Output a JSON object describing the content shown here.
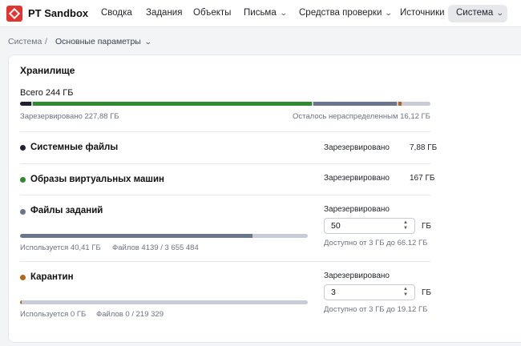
{
  "app": {
    "title": "PT Sandbox"
  },
  "nav": {
    "items": [
      {
        "label": "Сводка"
      },
      {
        "label": "Задания"
      },
      {
        "label": "Объекты"
      },
      {
        "label": "Письма"
      },
      {
        "label": "Средства проверки"
      },
      {
        "label": "Источники"
      },
      {
        "label": "Система"
      }
    ]
  },
  "breadcrumb": {
    "root": "Система",
    "separator": "/",
    "current": "Основные параметры"
  },
  "storage": {
    "title": "Хранилище",
    "total": "Всего 244 ГБ",
    "reserved": "Зарезервировано 227,88 ГБ",
    "remaining": "Осталось нераспределенным 16,12 ГБ",
    "segments": [
      {
        "name": "Системные файлы",
        "fraction": 0.032,
        "color": "#1f2329"
      },
      {
        "name": "Образы виртуальных машин",
        "fraction": 0.684,
        "color": "#2e8b2e"
      },
      {
        "name": "Файлы заданий",
        "fraction": 0.207,
        "color": "#6b7590"
      },
      {
        "name": "Карантин",
        "fraction": 0.012,
        "color": "#b5651d"
      }
    ]
  },
  "sections": {
    "system_files": {
      "title": "Системные файлы",
      "reserved_label": "Зарезервировано",
      "reserved_value": "7,88  ГБ",
      "color": "#1f2329"
    },
    "vm_images": {
      "title": "Образы виртуальных машин",
      "reserved_label": "Зарезервировано",
      "reserved_value": "167  ГБ",
      "color": "#2e8b2e"
    },
    "task_files": {
      "title": "Файлы заданий",
      "reserved_label": "Зарезервировано",
      "input_value": "50",
      "unit": "ГБ",
      "available": "Доступно от 3 ГБ до 66.12 ГБ",
      "used": "Используется 40,41 ГБ",
      "files": "Файлов 4139 / 3 655 484",
      "usage_fraction": 0.808,
      "color": "#6b7590"
    },
    "quarantine": {
      "title": "Карантин",
      "reserved_label": "Зарезервировано",
      "input_value": "3",
      "unit": "ГБ",
      "available": "Доступно от 3 ГБ до 19.12 ГБ",
      "used": "Используется 0 ГБ",
      "files": "Файлов 0 / 219 329",
      "usage_fraction": 0.005,
      "color": "#b5651d"
    }
  },
  "icons": {
    "logo": "pt-logo-icon",
    "chevron": "chevron-down-icon",
    "stepper": "stepper-icon"
  }
}
